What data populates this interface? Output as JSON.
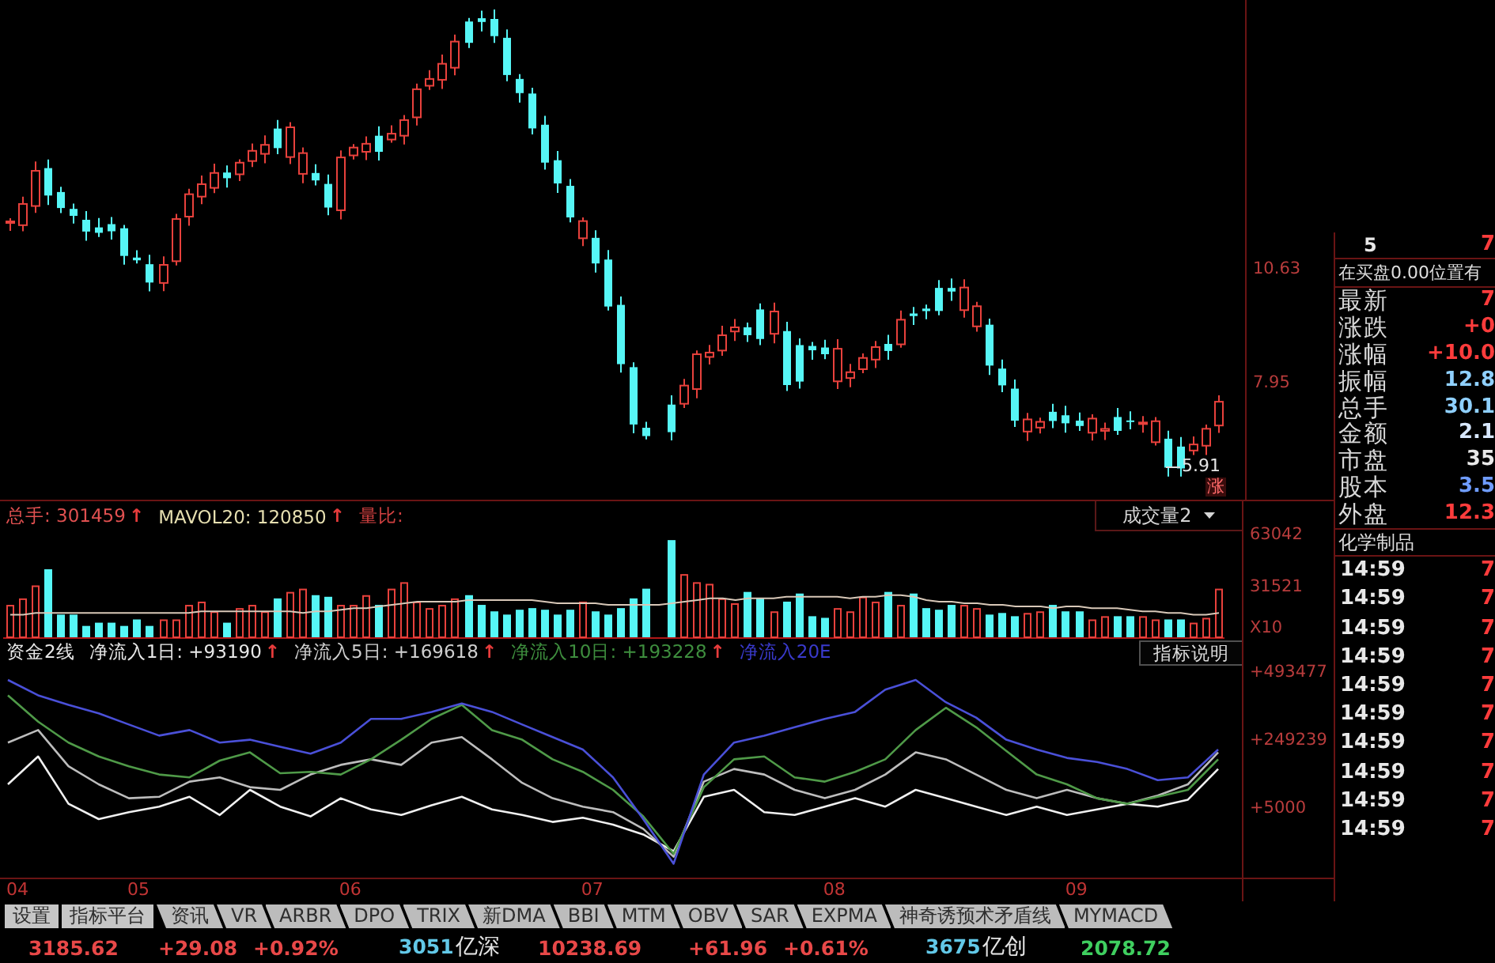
{
  "price_chart": {
    "axis_labels": [
      "10.63",
      "7.95"
    ],
    "low_label": "5.91",
    "badge": "涨"
  },
  "volume_chart": {
    "readings": [
      {
        "text": "总手: 301459",
        "arrow": "↑",
        "color": "#e05050"
      },
      {
        "text": "MAVOL20: 120850",
        "arrow": "↑",
        "color": "#e6dfb0"
      },
      {
        "text": "量比:",
        "color": "#d04040"
      }
    ],
    "selector": "成交量2",
    "unit_label": "X10",
    "chart_data": {
      "type": "bar",
      "ylim": [
        0,
        84000
      ],
      "yticks": [
        63042,
        31521
      ],
      "series": [
        {
          "values": [
            20000,
            24000,
            32000,
            42000,
            14000,
            14000,
            7000,
            9000,
            9000,
            7000,
            11000,
            7000,
            11000,
            11000,
            20000,
            22000,
            16000,
            9000,
            18000,
            20000,
            16000,
            24000,
            28000,
            30000,
            26000,
            25000,
            20000,
            20000,
            26000,
            20000,
            30000,
            34000,
            22000,
            18000,
            20000,
            24000,
            26000,
            20000,
            16000,
            14000,
            17000,
            18000,
            17000,
            14000,
            17000,
            22000,
            16000,
            14000,
            18000,
            24000,
            30000,
            null,
            60000,
            39000,
            34000,
            33000,
            24000,
            21000,
            28000,
            24000,
            16000,
            22000,
            27000,
            13000,
            12000,
            18000,
            16000,
            25000,
            22000,
            28000,
            20000,
            27000,
            18000,
            17000,
            20000,
            20000,
            18000,
            14000,
            15000,
            13000,
            15000,
            16000,
            20000,
            16000,
            16000,
            11000,
            13000,
            13000,
            13000,
            13000,
            11000,
            11000,
            11000,
            9000,
            12000,
            30000
          ],
          "colors": [
            "#e8413c",
            "#e8413c",
            "#e8413c",
            "#56f6f6",
            "#56f6f6",
            "#56f6f6",
            "#56f6f6",
            "#56f6f6",
            "#56f6f6",
            "#56f6f6",
            "#56f6f6",
            "#56f6f6",
            "#e8413c",
            "#e8413c",
            "#e8413c",
            "#e8413c",
            "#e8413c",
            "#56f6f6",
            "#e8413c",
            "#e8413c",
            "#e8413c",
            "#56f6f6",
            "#e8413c",
            "#e8413c",
            "#56f6f6",
            "#56f6f6",
            "#e8413c",
            "#e8413c",
            "#e8413c",
            "#56f6f6",
            "#e8413c",
            "#e8413c",
            "#e8413c",
            "#e8413c",
            "#e8413c",
            "#e8413c",
            "#56f6f6",
            "#56f6f6",
            "#56f6f6",
            "#56f6f6",
            "#56f6f6",
            "#56f6f6",
            "#56f6f6",
            "#56f6f6",
            "#56f6f6",
            "#e8413c",
            "#56f6f6",
            "#56f6f6",
            "#56f6f6",
            "#56f6f6",
            "#56f6f6",
            null,
            "#56f6f6",
            "#e8413c",
            "#e8413c",
            "#e8413c",
            "#e8413c",
            "#e8413c",
            "#56f6f6",
            "#56f6f6",
            "#e8413c",
            "#56f6f6",
            "#56f6f6",
            "#56f6f6",
            "#56f6f6",
            "#e8413c",
            "#e8413c",
            "#e8413c",
            "#e8413c",
            "#56f6f6",
            "#e8413c",
            "#56f6f6",
            "#56f6f6",
            "#56f6f6",
            "#56f6f6",
            "#e8413c",
            "#e8413c",
            "#56f6f6",
            "#56f6f6",
            "#56f6f6",
            "#e8413c",
            "#e8413c",
            "#56f6f6",
            "#56f6f6",
            "#56f6f6",
            "#e8413c",
            "#e8413c",
            "#56f6f6",
            "#56f6f6",
            "#e8413c",
            "#e8413c",
            "#56f6f6",
            "#56f6f6",
            "#e8413c",
            "#e8413c",
            "#e8413c"
          ]
        },
        {
          "type": "line",
          "color": "#d8c8b8",
          "values": [
            14000,
            14000,
            15000,
            15000,
            15000,
            15000,
            15000,
            15000,
            15000,
            15000,
            15000,
            15000,
            15000,
            15000,
            15000,
            16000,
            16000,
            16000,
            16000,
            16000,
            16000,
            16000,
            16000,
            15000,
            16000,
            16000,
            17000,
            18000,
            18000,
            19000,
            20000,
            21000,
            22000,
            22000,
            22000,
            22000,
            23000,
            23000,
            23000,
            23000,
            23000,
            23000,
            22000,
            21000,
            21000,
            21000,
            21000,
            20000,
            20000,
            20000,
            20000,
            20000,
            21000,
            22000,
            23000,
            24000,
            24000,
            23000,
            24000,
            24000,
            24000,
            25000,
            25000,
            25000,
            25000,
            25000,
            24000,
            25000,
            25000,
            26000,
            26000,
            25000,
            23000,
            22000,
            22000,
            21000,
            21000,
            20000,
            20000,
            19000,
            19000,
            19000,
            18000,
            19000,
            19000,
            18000,
            18000,
            18000,
            17000,
            16000,
            16000,
            15000,
            15000,
            14000,
            14000,
            15000
          ]
        }
      ]
    }
  },
  "flow_chart": {
    "title": "资金2线",
    "legend": [
      {
        "text": "净流入1日: +93190",
        "arrow": "↑",
        "color": "#e8e8e8"
      },
      {
        "text": "净流入5日: +169618",
        "arrow": "↑",
        "color": "#cfcfcf"
      },
      {
        "text": "净流入10日: +193228",
        "arrow": "↑",
        "color": "#3e8e3e"
      },
      {
        "text": "净流入20E",
        "color": "#3a3acc"
      }
    ],
    "button": "指标说明",
    "chart_data": {
      "type": "line",
      "categories": [
        "04",
        null,
        null,
        null,
        "05",
        null,
        null,
        null,
        null,
        null,
        null,
        "06",
        null,
        null,
        null,
        null,
        null,
        null,
        null,
        "07",
        null,
        null,
        null,
        null,
        null,
        null,
        null,
        "08",
        null,
        null,
        null,
        null,
        null,
        null,
        null,
        "09",
        null,
        null,
        null,
        null,
        null
      ],
      "ylim": [
        -245000,
        516000
      ],
      "yticks": [
        {
          "value": 493477,
          "label": "+493477"
        },
        {
          "value": 249239,
          "label": "+249239"
        },
        {
          "value": 5000,
          "label": "+5000"
        }
      ],
      "series": [
        {
          "color": "#f0f0f0",
          "values": [
            90000,
            190000,
            20000,
            -35000,
            -10000,
            10000,
            45000,
            -20000,
            70000,
            10000,
            -25000,
            40000,
            0,
            -20000,
            15000,
            45000,
            0,
            -20000,
            -45000,
            -30000,
            -55000,
            -90000,
            -150000,
            45000,
            70000,
            -10000,
            -20000,
            10000,
            40000,
            10000,
            70000,
            40000,
            10000,
            -20000,
            10000,
            -20000,
            0,
            20000,
            10000,
            35000,
            145000
          ]
        },
        {
          "color": "#bdbdbd",
          "values": [
            240000,
            285000,
            155000,
            90000,
            40000,
            45000,
            100000,
            115000,
            80000,
            70000,
            125000,
            160000,
            180000,
            160000,
            240000,
            260000,
            180000,
            95000,
            40000,
            10000,
            -10000,
            -70000,
            -170000,
            100000,
            145000,
            125000,
            70000,
            40000,
            70000,
            125000,
            205000,
            180000,
            125000,
            70000,
            40000,
            70000,
            40000,
            20000,
            50000,
            90000,
            205000
          ]
        },
        {
          "color": "#4f9a48",
          "values": [
            410000,
            315000,
            240000,
            190000,
            155000,
            125000,
            115000,
            175000,
            205000,
            130000,
            135000,
            125000,
            180000,
            250000,
            325000,
            375000,
            285000,
            250000,
            180000,
            135000,
            70000,
            -25000,
            -160000,
            80000,
            180000,
            190000,
            115000,
            100000,
            135000,
            180000,
            285000,
            365000,
            295000,
            210000,
            125000,
            90000,
            40000,
            20000,
            45000,
            70000,
            180000
          ]
        },
        {
          "color": "#4a50d8",
          "values": [
            465000,
            410000,
            375000,
            345000,
            305000,
            265000,
            285000,
            240000,
            250000,
            225000,
            200000,
            240000,
            325000,
            325000,
            350000,
            380000,
            350000,
            305000,
            260000,
            215000,
            115000,
            -35000,
            -195000,
            125000,
            240000,
            265000,
            295000,
            325000,
            350000,
            430000,
            465000,
            385000,
            330000,
            250000,
            215000,
            185000,
            170000,
            145000,
            105000,
            115000,
            215000
          ]
        }
      ]
    }
  },
  "quote_panel": {
    "order_row": {
      "row_label": "5",
      "price": "7"
    },
    "notice": "在买盘0.00位置有",
    "fields": [
      {
        "label": "最新",
        "value": "7",
        "color": "#ff3c3c"
      },
      {
        "label": "涨跌",
        "value": "+0",
        "color": "#ff3c3c"
      },
      {
        "label": "涨幅",
        "value": "+10.0",
        "color": "#ff3c3c"
      },
      {
        "label": "振幅",
        "value": "12.8",
        "color": "#8fd0ff"
      },
      {
        "label": "总手",
        "value": "30.1",
        "color": "#8fd0ff"
      },
      {
        "label": "金额",
        "value": "2.1",
        "color": "#d8e8ff"
      },
      {
        "label": "市盘",
        "value": "35",
        "color": "#e8e8e8"
      },
      {
        "label": "股本",
        "value": "3.5",
        "color": "#6f9cff"
      },
      {
        "label": "外盘",
        "value": "12.3",
        "color": "#ff3c3c"
      }
    ],
    "industry": "化学制品",
    "ticks": [
      {
        "time": "14:59",
        "price": "7"
      },
      {
        "time": "14:59",
        "price": "7"
      },
      {
        "time": "14:59",
        "price": "7"
      },
      {
        "time": "14:59",
        "price": "7"
      },
      {
        "time": "14:59",
        "price": "7"
      },
      {
        "time": "14:59",
        "price": "7"
      },
      {
        "time": "14:59",
        "price": "7"
      },
      {
        "time": "14:59",
        "price": "7"
      },
      {
        "time": "14:59",
        "price": "7"
      },
      {
        "time": "14:59",
        "price": "7"
      }
    ]
  },
  "tabs": [
    {
      "label": "设置",
      "kind": "button"
    },
    {
      "label": "指标平台",
      "kind": "button"
    },
    {
      "label": "资讯",
      "kind": "tab"
    },
    {
      "label": "VR",
      "kind": "tab"
    },
    {
      "label": "ARBR",
      "kind": "tab"
    },
    {
      "label": "DPO",
      "kind": "tab"
    },
    {
      "label": "TRIX",
      "kind": "tab"
    },
    {
      "label": "新DMA",
      "kind": "tab"
    },
    {
      "label": "BBI",
      "kind": "tab"
    },
    {
      "label": "MTM",
      "kind": "tab"
    },
    {
      "label": "OBV",
      "kind": "tab"
    },
    {
      "label": "SAR",
      "kind": "tab"
    },
    {
      "label": "EXPMA",
      "kind": "tab"
    },
    {
      "label": "神奇诱预术矛盾线",
      "kind": "tab"
    },
    {
      "label": "MYMACD",
      "kind": "tab"
    }
  ],
  "status_bar": [
    {
      "kind": "value",
      "text": "3185.62",
      "color": "#e84848"
    },
    {
      "kind": "value",
      "text": "+29.08",
      "color": "#e84848"
    },
    {
      "kind": "value",
      "text": "+0.92%",
      "color": "#e84848"
    },
    {
      "kind": "turnover",
      "amount": "3051",
      "unit": "亿深",
      "color": "#62c8e8"
    },
    {
      "kind": "value",
      "text": "10238.69",
      "color": "#e84848"
    },
    {
      "kind": "value",
      "text": "+61.96",
      "color": "#e84848"
    },
    {
      "kind": "value",
      "text": "+0.61%",
      "color": "#e84848"
    },
    {
      "kind": "turnover",
      "amount": "3675",
      "unit": "亿创",
      "color": "#62c8e8"
    },
    {
      "kind": "value",
      "text": "2078.72",
      "color": "#3fcf5f"
    }
  ]
}
